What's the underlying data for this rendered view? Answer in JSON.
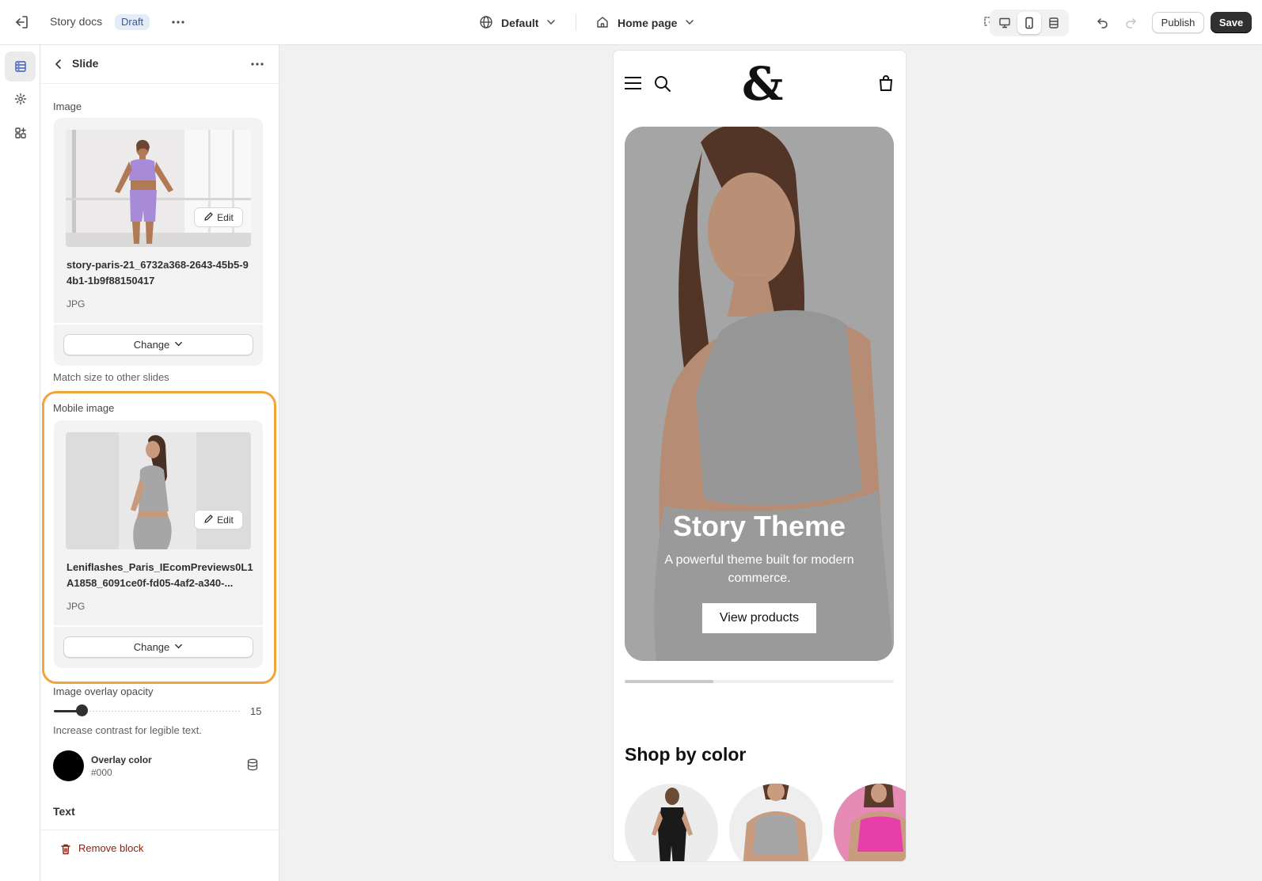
{
  "topbar": {
    "store_name": "Story docs",
    "status_badge": "Draft",
    "theme_selector": "Default",
    "page_selector": "Home page",
    "publish_label": "Publish",
    "save_label": "Save",
    "active_device": "mobile"
  },
  "sidebar": {
    "header_title": "Slide",
    "image": {
      "label": "Image",
      "filename": "story-paris-21_6732a368-2643-45b5-94b1-1b9f88150417",
      "filetype": "JPG",
      "edit_label": "Edit",
      "change_label": "Change"
    },
    "match_size_help": "Match size to other slides",
    "mobile_image": {
      "label": "Mobile image",
      "filename": "Leniflashes_Paris_IEcomPreviews0L1A1858_6091ce0f-fd05-4af2-a340-...",
      "filetype": "JPG",
      "edit_label": "Edit",
      "change_label": "Change"
    },
    "overlay_opacity": {
      "label": "Image overlay opacity",
      "value": "15",
      "fraction": 0.15,
      "help": "Increase contrast for legible text."
    },
    "overlay_color": {
      "label": "Overlay color",
      "value": "#000"
    },
    "text_section": "Text",
    "remove_block": "Remove block"
  },
  "preview": {
    "logo": "&",
    "hero_title": "Story Theme",
    "hero_subtitle": "A powerful theme built for modern commerce.",
    "hero_button": "View products",
    "slideshow_progress": 0.33,
    "shop_by_color_title": "Shop by color",
    "color_swatches": [
      "black",
      "grey",
      "pink"
    ]
  },
  "colors": {
    "accent_highlight": "#f2a33c",
    "save_button": "#303030",
    "badge_bg": "#e3ecf8",
    "danger_text": "#8e1f0b"
  }
}
